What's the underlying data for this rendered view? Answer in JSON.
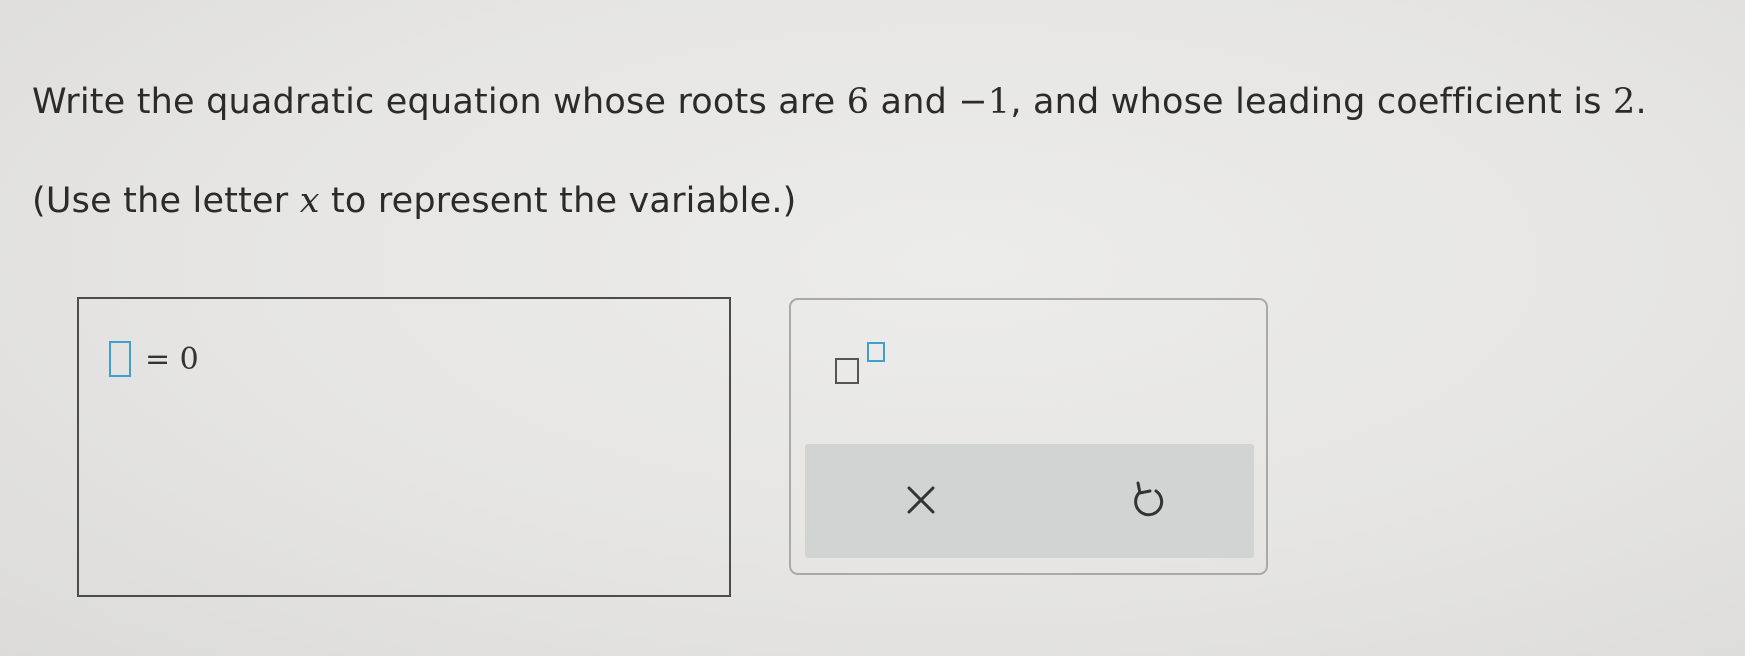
{
  "question": {
    "text_before_roots": "Write the quadratic equation whose roots are ",
    "root1": "6",
    "text_between_roots": " and ",
    "root2": "−1",
    "text_after_roots": ", and whose leading coefficient is ",
    "leading_coefficient": "2",
    "text_end": "."
  },
  "hint": {
    "text_before": "(Use the letter ",
    "variable": "x",
    "text_after": " to represent the variable.)"
  },
  "answer": {
    "input_value": "",
    "equals_text": "= 0"
  },
  "toolbar": {
    "exponent_icon": "superscript-template-icon",
    "clear_icon": "close-icon",
    "undo_icon": "undo-icon",
    "accent_color": "#3f9fcf",
    "action_bar_color": "#d2d3d3"
  }
}
